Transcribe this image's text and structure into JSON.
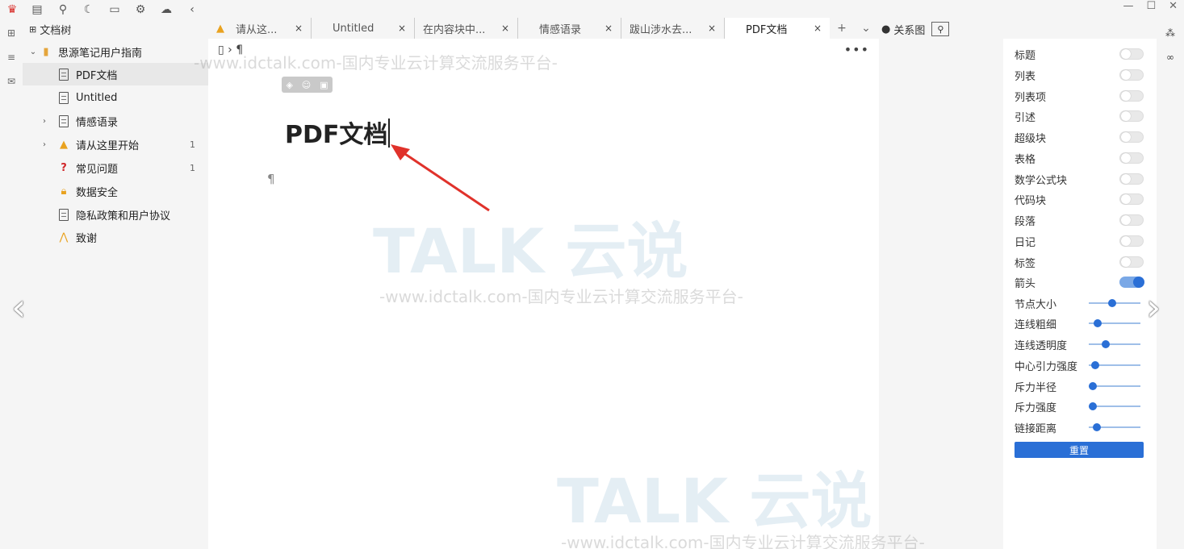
{
  "toolbar": {
    "icons": [
      "crown-icon",
      "calendar-icon",
      "search-icon",
      "moon-icon",
      "video-icon",
      "gear-icon",
      "cloud-icon",
      "collapse-icon"
    ]
  },
  "filetree": {
    "title": "文档树",
    "notebook": "思源笔记用户指南",
    "items": [
      {
        "label": "PDF文档",
        "count": ""
      },
      {
        "label": "Untitled",
        "count": ""
      },
      {
        "label": "情感语录",
        "count": ""
      },
      {
        "label": "请从这里开始",
        "count": "1"
      },
      {
        "label": "常见问题",
        "count": "1"
      },
      {
        "label": "数据安全",
        "count": ""
      },
      {
        "label": "隐私政策和用户协议",
        "count": ""
      },
      {
        "label": "致谢",
        "count": ""
      }
    ]
  },
  "tabs": [
    {
      "label": "请从这..."
    },
    {
      "label": "Untitled"
    },
    {
      "label": "在内容块中..."
    },
    {
      "label": "情感语录"
    },
    {
      "label": "跋山涉水去..."
    },
    {
      "label": "PDF文档"
    }
  ],
  "editor": {
    "breadcrumb": "› ¶",
    "title": "PDF文档",
    "paragraph_mark": "¶",
    "more": "•••"
  },
  "graph": {
    "title": "关系图",
    "toggles": [
      {
        "label": "标题",
        "on": false
      },
      {
        "label": "列表",
        "on": false
      },
      {
        "label": "列表项",
        "on": false
      },
      {
        "label": "引述",
        "on": false
      },
      {
        "label": "超级块",
        "on": false
      },
      {
        "label": "表格",
        "on": false
      },
      {
        "label": "数学公式块",
        "on": false
      },
      {
        "label": "代码块",
        "on": false
      },
      {
        "label": "段落",
        "on": false
      },
      {
        "label": "日记",
        "on": false
      },
      {
        "label": "标签",
        "on": false
      },
      {
        "label": "箭头",
        "on": true
      }
    ],
    "sliders": [
      {
        "label": "节点大小",
        "value": 0.45
      },
      {
        "label": "连线粗细",
        "value": 0.12
      },
      {
        "label": "连线透明度",
        "value": 0.3
      },
      {
        "label": "中心引力强度",
        "value": 0.05
      },
      {
        "label": "斥力半径",
        "value": 0.0
      },
      {
        "label": "斥力强度",
        "value": 0.0
      },
      {
        "label": "链接距离",
        "value": 0.1
      }
    ],
    "reset_label": "重置"
  },
  "watermark": {
    "brand": "TALK 云说",
    "site": "-www.idctalk.com-国内专业云计算交流服务平台-"
  }
}
